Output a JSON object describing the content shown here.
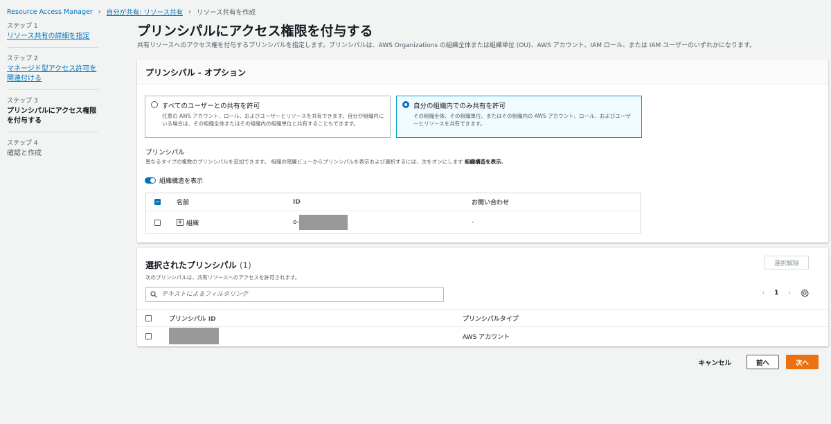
{
  "breadcrumb": {
    "items": [
      "Resource Access Manager",
      "自分が共有: リソース共有",
      "リソース共有を作成"
    ]
  },
  "steps": [
    {
      "num": "ステップ 1",
      "title": "リソース共有の詳細を指定"
    },
    {
      "num": "ステップ 2",
      "title": "マネージド型アクセス許可を関連付ける"
    },
    {
      "num": "ステップ 3",
      "title": "プリンシパルにアクセス権限を付与する"
    },
    {
      "num": "ステップ 4",
      "title": "確認と作成"
    }
  ],
  "page": {
    "title": "プリンシパルにアクセス権限を付与する",
    "description": "共有リソースへのアクセス権を付与するプリンシパルを指定します。プリンシパルは、AWS Organizations の組織全体または組織単位 (OU)、AWS アカウント、IAM ロール、または IAM ユーザーのいずれかになります。"
  },
  "principals_panel": {
    "title": "プリンシパル - オプション",
    "options": [
      {
        "title": "すべてのユーザーとの共有を許可",
        "desc": "任意の AWS アカウント、ロール、およびユーザーとリソースを共有できます。自分が組織内にいる場合は、その組織全体またはその組織内の組織単位と共有することもできます。",
        "selected": false
      },
      {
        "title": "自分の組織内でのみ共有を許可",
        "desc": "その組織全体、その組織単位、またはその組織内の AWS アカウント、ロール、およびユーザーとリソースを共有できます。",
        "selected": true
      }
    ],
    "principal_label": "プリンシパル",
    "principal_desc": "異なるタイプの複数のプリンシパルを追加できます。 組織の階層ビューからプリンシパルを表示および選択するには、次をオンにします",
    "principal_desc_bold": "組織構造を表示.",
    "toggle_label": "組織構造を表示",
    "table": {
      "headers": [
        "名前",
        "ID",
        "お問い合わせ"
      ],
      "rows": [
        {
          "name": "組織",
          "id_prefix": "o-",
          "contact": "-"
        }
      ]
    }
  },
  "selected_panel": {
    "title": "選択されたプリンシパル",
    "count": "(1)",
    "desc": "次のプリンシパルは、共有リソースへのアクセスを許可されます。",
    "deselect_label": "選択解除",
    "filter_placeholder": "テキストによるフィルタリング",
    "pager": {
      "prev": "‹",
      "page": "1",
      "next": "›"
    },
    "headers": [
      "プリンシパル ID",
      "プリンシパルタイプ"
    ],
    "rows": [
      {
        "type": "AWS アカウント"
      }
    ]
  },
  "footer": {
    "cancel": "キャンセル",
    "prev": "前へ",
    "next": "次へ"
  },
  "colors": {
    "accent": "#0073bb",
    "primary_button": "#ec7211"
  }
}
